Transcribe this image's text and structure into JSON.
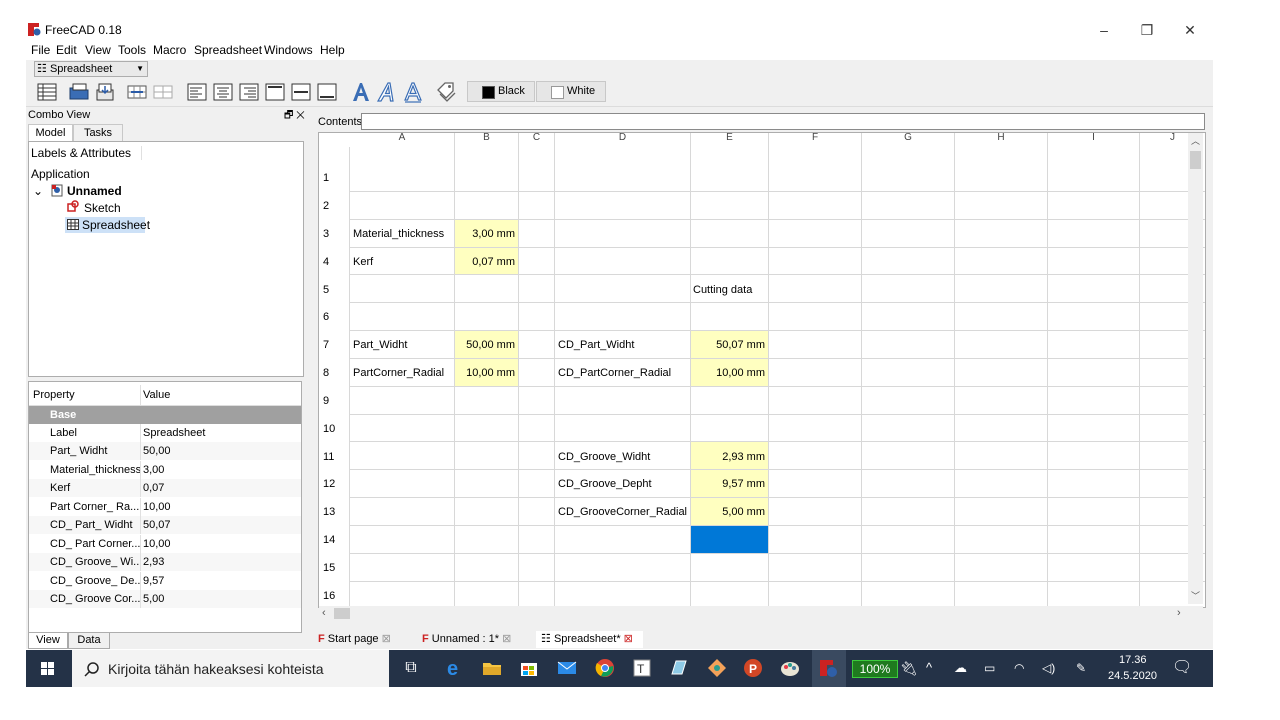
{
  "window": {
    "title": "FreeCAD 0.18"
  },
  "menu": [
    "File",
    "Edit",
    "View",
    "Tools",
    "Macro",
    "Spreadsheet",
    "Windows",
    "Help"
  ],
  "workbench": {
    "selected": "Spreadsheet"
  },
  "toolbar": {
    "black_label": "Black",
    "white_label": "White"
  },
  "combo": {
    "title": "Combo View",
    "tabs": [
      "Model",
      "Tasks"
    ],
    "tree_header": "Labels & Attributes",
    "tree_root": "Application",
    "document": "Unnamed",
    "children": [
      "Sketch",
      "Spreadsheet"
    ]
  },
  "properties": {
    "header_property": "Property",
    "header_value": "Value",
    "group": "Base",
    "rows": [
      {
        "k": "Label",
        "v": "Spreadsheet"
      },
      {
        "k": "Part_ Widht",
        "v": "50,00"
      },
      {
        "k": "Material_thickness",
        "v": "3,00"
      },
      {
        "k": "Kerf",
        "v": "0,07"
      },
      {
        "k": "Part Corner_ Ra...",
        "v": "10,00"
      },
      {
        "k": "CD_ Part_ Widht",
        "v": "50,07"
      },
      {
        "k": "CD_ Part Corner...",
        "v": "10,00"
      },
      {
        "k": "CD_ Groove_ Wi...",
        "v": "2,93"
      },
      {
        "k": "CD_ Groove_ De...",
        "v": "9,57"
      },
      {
        "k": "CD_ Groove Cor...",
        "v": "5,00"
      }
    ],
    "bottom_tabs": [
      "View",
      "Data"
    ]
  },
  "sheet": {
    "contents_label": "Contents",
    "columns": [
      "A",
      "B",
      "C",
      "D",
      "E",
      "F",
      "G",
      "H",
      "I",
      "J"
    ],
    "rows": [
      "1",
      "2",
      "3",
      "4",
      "5",
      "6",
      "7",
      "8",
      "9",
      "10",
      "11",
      "12",
      "13",
      "14",
      "15",
      "16"
    ],
    "cells": {
      "A3": "Material_thickness",
      "B3": "3,00 mm",
      "A4": "Kerf",
      "B4": "0,07 mm",
      "E5": "Cutting data",
      "A7": "Part_Widht",
      "B7": "50,00 mm",
      "D7": "CD_Part_Widht",
      "E7": "50,07 mm",
      "A8": "PartCorner_Radial",
      "B8": "10,00 mm",
      "D8": "CD_PartCorner_Radial",
      "E8": "10,00 mm",
      "D11": "CD_Groove_Widht",
      "E11": "2,93 mm",
      "D12": "CD_Groove_Depht",
      "E12": "9,57 mm",
      "D13": "CD_GrooveCorner_Radial",
      "E13": "5,00 mm"
    },
    "highlight_color": "#ffffc0",
    "selection_color": "#0078d7"
  },
  "doc_tabs": [
    "Start page",
    "Unnamed : 1*",
    "Spreadsheet*"
  ],
  "taskbar": {
    "search_placeholder": "Kirjoita tähän hakeaksesi kohteista",
    "battery": "100%",
    "time": "17.36",
    "date": "24.5.2020"
  }
}
